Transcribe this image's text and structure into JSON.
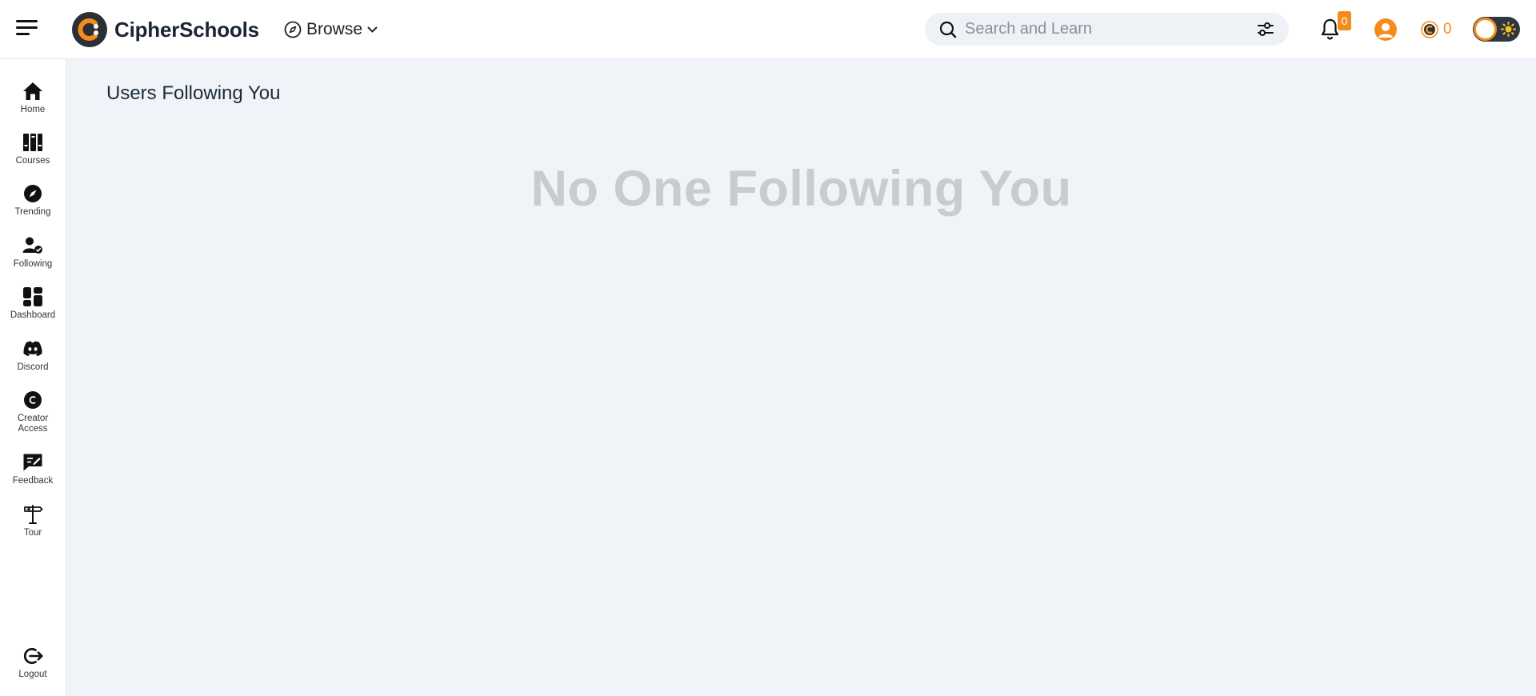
{
  "header": {
    "brand_name": "CipherSchools",
    "browse_label": "Browse",
    "search_placeholder": "Search and Learn",
    "notification_count": "0",
    "coin_count": "0",
    "accent_color": "#f48c1b"
  },
  "sidebar": {
    "items": [
      {
        "label": "Home",
        "icon": "home-icon"
      },
      {
        "label": "Courses",
        "icon": "courses-icon"
      },
      {
        "label": "Trending",
        "icon": "compass-icon"
      },
      {
        "label": "Following",
        "icon": "user-check-icon"
      },
      {
        "label": "Dashboard",
        "icon": "dashboard-icon"
      },
      {
        "label": "Discord",
        "icon": "discord-icon"
      },
      {
        "label": "Creator Access",
        "icon": "creator-icon"
      },
      {
        "label": "Feedback",
        "icon": "feedback-icon"
      },
      {
        "label": "Tour",
        "icon": "signpost-icon"
      }
    ],
    "logout_label": "Logout"
  },
  "main": {
    "title": "Users Following You",
    "empty_message": "No One Following You"
  }
}
